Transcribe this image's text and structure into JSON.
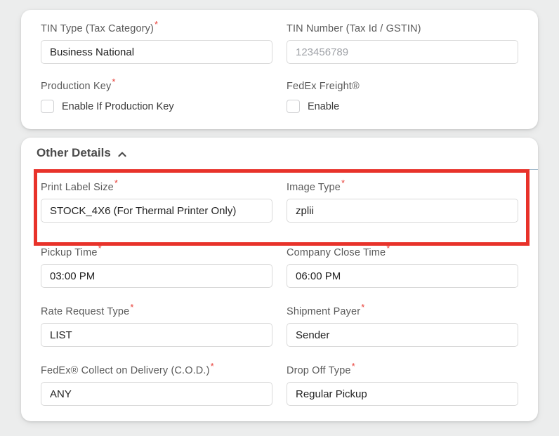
{
  "theme": {
    "page_background": "#eceded",
    "panel_background": "#ffffff",
    "required_marker_color": "#e8413a",
    "highlight_border_color": "#e8322a",
    "divider_color": "#9db6c9",
    "label_color": "#5a5a5a",
    "value_color": "#222222",
    "placeholder_color": "#a0a3a8"
  },
  "top_panel": {
    "fields": {
      "tin_type": {
        "label": "TIN Type (Tax Category)",
        "required": true,
        "value": "Business National"
      },
      "tin_number": {
        "label": "TIN Number (Tax Id / GSTIN)",
        "required": false,
        "value": "",
        "placeholder": "123456789"
      },
      "production_key": {
        "label": "Production Key",
        "required": true,
        "checkbox_label": "Enable If Production Key",
        "checked": false
      },
      "fedex_freight": {
        "label": "FedEx Freight®",
        "required": false,
        "checkbox_label": "Enable",
        "checked": false
      }
    }
  },
  "other_details": {
    "title": "Other Details",
    "collapse_icon": "chevron-up-icon",
    "expanded": true,
    "fields": {
      "print_label_size": {
        "label": "Print Label Size",
        "required": true,
        "value": "STOCK_4X6 (For Thermal Printer Only)",
        "highlighted": true
      },
      "image_type": {
        "label": "Image Type",
        "required": true,
        "value": "zplii",
        "highlighted": true
      },
      "pickup_time": {
        "label": "Pickup Time",
        "required": true,
        "value": "03:00 PM"
      },
      "company_close_time": {
        "label": "Company Close Time",
        "required": true,
        "value": "06:00 PM"
      },
      "rate_request_type": {
        "label": "Rate Request Type",
        "required": true,
        "value": "LIST"
      },
      "shipment_payer": {
        "label": "Shipment Payer",
        "required": true,
        "value": "Sender"
      },
      "cod": {
        "label": "FedEx® Collect on Delivery (C.O.D.)",
        "required": true,
        "value": "ANY"
      },
      "drop_off_type": {
        "label": "Drop Off Type",
        "required": true,
        "value": "Regular Pickup"
      }
    }
  }
}
